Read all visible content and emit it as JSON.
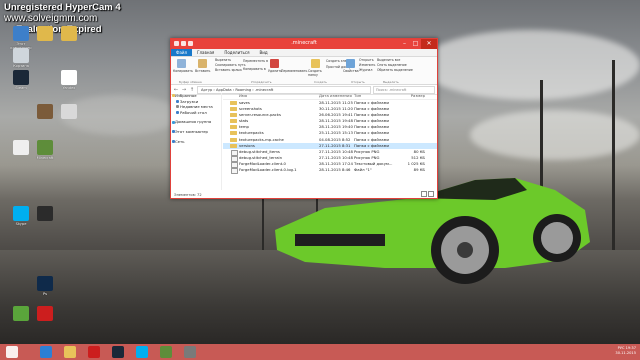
{
  "watermark": {
    "line1": "Unregistered HyperCam 4",
    "line2": "www.solveigmm.com",
    "line3": "Evaluation Expired"
  },
  "desktop": {
    "icons": [
      {
        "name": "computer-icon",
        "label": "Этот компьютер",
        "color": "#3d7fc9"
      },
      {
        "name": "folder-icon-a",
        "label": "",
        "color": "#e0b84b"
      },
      {
        "name": "folder-icon-b",
        "label": "",
        "color": "#e0b84b"
      },
      {
        "name": "recycle-bin-icon",
        "label": "Корзина",
        "color": "#cfd6dc"
      },
      {
        "name": "steam-icon",
        "label": "Steam",
        "color": "#1b2838"
      },
      {
        "name": "yandex-icon",
        "label": "Yandex",
        "color": "#ffffff"
      },
      {
        "name": "app-icon-1",
        "label": "",
        "color": "#7b5b3a"
      },
      {
        "name": "app-icon-2",
        "label": "",
        "color": "#d9d9d9"
      },
      {
        "name": "doc-icon",
        "label": "",
        "color": "#efefef"
      },
      {
        "name": "minecraft-icon",
        "label": "Minecraft",
        "color": "#5e8d3a"
      },
      {
        "name": "skype-icon",
        "label": "Skype",
        "color": "#00aff0"
      },
      {
        "name": "game-icon",
        "label": "",
        "color": "#2b2b2b"
      },
      {
        "name": "photoshop-icon",
        "label": "Ps",
        "color": "#0f2a4a"
      },
      {
        "name": "opera-icon",
        "label": "",
        "color": "#cc1e1e"
      },
      {
        "name": "utorrent-icon",
        "label": "",
        "color": "#5aa53b"
      }
    ]
  },
  "window": {
    "title": ".minecraft",
    "tabs": [
      "Файл",
      "Главная",
      "Поделиться",
      "Вид"
    ],
    "ribbon": {
      "copy": "Копировать",
      "paste": "Вставить",
      "cut": "Вырезать",
      "copy_path": "Скопировать путь",
      "paste_shortcut": "Вставить ярлык",
      "move_to": "Переместить в",
      "copy_to": "Копировать в",
      "delete": "Удалить",
      "rename": "Переименовать",
      "new_folder": "Создать папку",
      "new_item": "Создать элемент",
      "easy_access": "Простой доступ",
      "properties": "Свойства",
      "open": "Открыть",
      "edit": "Изменить",
      "history": "Журнал",
      "select_all": "Выделить все",
      "select_none": "Снять выделение",
      "invert": "Обратить выделение",
      "groups": [
        "Буфер обмена",
        "Упорядочить",
        "Создать",
        "Открыть",
        "Выделить"
      ]
    },
    "address": {
      "path": [
        "Артур",
        "AppData",
        "Roaming",
        ".minecraft"
      ],
      "search_placeholder": "Поиск: .minecraft"
    },
    "nav_pane": [
      {
        "label": "Избранное",
        "indent": false,
        "color": "#e8c25a"
      },
      {
        "label": "Загрузки",
        "indent": true,
        "color": "#3d7fc9"
      },
      {
        "label": "Недавние места",
        "indent": true,
        "color": "#8a8a8a"
      },
      {
        "label": "Рабочий стол",
        "indent": true,
        "color": "#3d7fc9"
      },
      {
        "label": "Домашняя группа",
        "indent": false,
        "color": "#3a9ad9",
        "gap": true
      },
      {
        "label": "Этот компьютер",
        "indent": false,
        "color": "#3d7fc9",
        "gap": true
      },
      {
        "label": "Сеть",
        "indent": false,
        "color": "#3d7fc9",
        "gap": true
      }
    ],
    "columns": [
      "Имя",
      "Дата изменения",
      "Тип",
      "Размер"
    ],
    "files": [
      {
        "name": "saves",
        "date": "28.11.2015 11:25",
        "type": "Папка с файлами",
        "size": "",
        "kind": "folder",
        "selected": false
      },
      {
        "name": "screenshots",
        "date": "30.11.2015 11:20",
        "type": "Папка с файлами",
        "size": "",
        "kind": "folder",
        "selected": false
      },
      {
        "name": "server-resource-packs",
        "date": "26.06.2015 19:41",
        "type": "Папка с файлами",
        "size": "",
        "kind": "folder",
        "selected": false
      },
      {
        "name": "stats",
        "date": "28.11.2015 19:48",
        "type": "Папка с файлами",
        "size": "",
        "kind": "folder",
        "selected": false
      },
      {
        "name": "temp",
        "date": "28.11.2015 19:40",
        "type": "Папка с файлами",
        "size": "",
        "kind": "folder",
        "selected": false
      },
      {
        "name": "texturepacks",
        "date": "25.11.2015 15:13",
        "type": "Папка с файлами",
        "size": "",
        "kind": "folder",
        "selected": false
      },
      {
        "name": "texturepacks-mp-cache",
        "date": "04.08.2015 8:52",
        "type": "Папка с файлами",
        "size": "",
        "kind": "folder",
        "selected": false
      },
      {
        "name": "versions",
        "date": "27.11.2015 8:31",
        "type": "Папка с файлами",
        "size": "",
        "kind": "folder",
        "selected": true
      },
      {
        "name": "debug.stitched_items",
        "date": "27.11.2015 10:48",
        "type": "Рисунок PNG",
        "size": "80 КБ",
        "kind": "doc",
        "selected": false
      },
      {
        "name": "debug.stitched_terrain",
        "date": "27.11.2015 10:48",
        "type": "Рисунок PNG",
        "size": "512 КБ",
        "kind": "doc",
        "selected": false
      },
      {
        "name": "ForgeModLoader-client-0",
        "date": "28.11.2015 17:24",
        "type": "Текстовый докум...",
        "size": "1 025 КБ",
        "kind": "doc",
        "selected": false
      },
      {
        "name": "ForgeModLoader-client-0.log.1",
        "date": "28.11.2015 8:46",
        "type": "Файл \"1\"",
        "size": "89 КБ",
        "kind": "doc",
        "selected": false
      }
    ],
    "status": "Элементов: 72"
  },
  "taskbar": {
    "lang": "РУС",
    "time": "19:37",
    "date": "30.11.2015"
  },
  "colors": {
    "accent": "#e8423b",
    "taskbar": "#c85a55",
    "selection": "#cce8ff",
    "car": "#6cc92a"
  }
}
